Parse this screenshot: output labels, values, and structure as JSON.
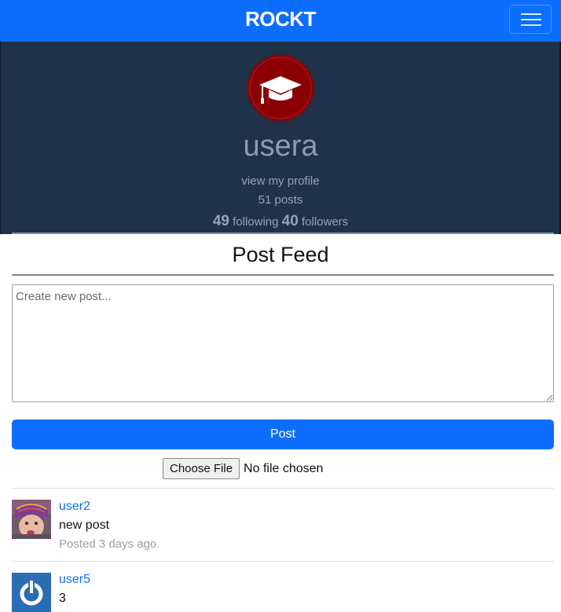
{
  "navbar": {
    "brand": "ROCKT",
    "brand_color": "#0d6efd",
    "menu_icon": "hamburger-menu-icon"
  },
  "profile": {
    "badge_icon": "graduation-cap-badge-icon",
    "badge_color": "#8b0000",
    "username": "usera",
    "view_profile_label": "view my profile",
    "posts_label": "51 posts",
    "following_count": "49",
    "following_label": "following",
    "followers_count": "40",
    "followers_label": "followers"
  },
  "feed": {
    "title": "Post Feed",
    "placeholder": "Create new post...",
    "post_button": "Post",
    "choose_file_label": "Choose File",
    "file_status": "No file chosen"
  },
  "posts": [
    {
      "user": "user2",
      "text": "new post",
      "time": "Posted 3 days ago.",
      "avatar": "baby-photo-avatar"
    },
    {
      "user": "user5",
      "text": "3",
      "time": "",
      "avatar": "power-icon-avatar"
    }
  ]
}
